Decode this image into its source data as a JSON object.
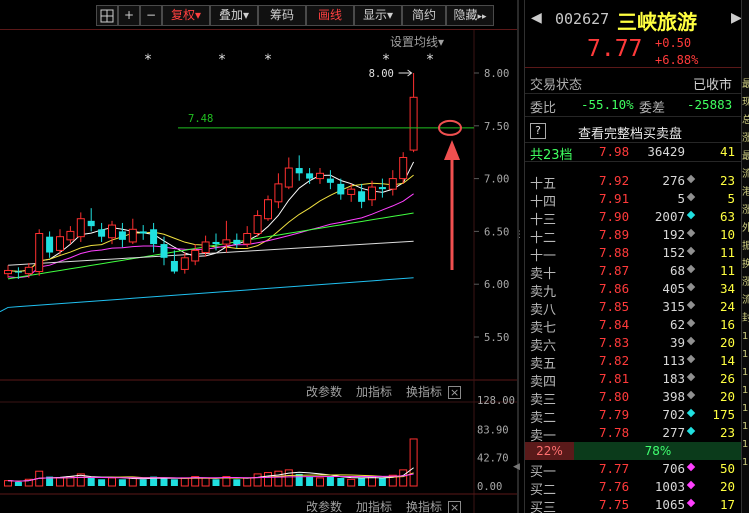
{
  "toolbar": {
    "grid_icon": "grid-icon",
    "plus": "+",
    "minus": "−",
    "buttons": [
      {
        "label": "复权",
        "has_dropdown": true,
        "red": true
      },
      {
        "label": "叠加",
        "has_dropdown": true,
        "red": false
      },
      {
        "label": "筹码",
        "has_dropdown": false,
        "red": false
      },
      {
        "label": "画线",
        "has_dropdown": false,
        "red": true
      },
      {
        "label": "显示",
        "has_dropdown": true,
        "red": false
      },
      {
        "label": "简约",
        "has_dropdown": false,
        "red": false
      },
      {
        "label": "隐藏",
        "has_dropdown": false,
        "red": false
      }
    ],
    "more": "▸▸",
    "settings": "设置均线",
    "dropdown_arrow": "▾"
  },
  "main_chart": {
    "y_ticks": [
      "8.00",
      "7.50",
      "7.00",
      "6.50",
      "6.00",
      "5.50"
    ],
    "annotation_high": "8.00",
    "annotation_line": "7.48",
    "star": "*",
    "colors": {
      "up": "#ff3030",
      "down": "#20e0e0",
      "ma5": "#ffffff",
      "ma10": "#f0e040",
      "ma20": "#ff40ff",
      "ma30": "#40ff40",
      "ma60": "#dcdcdc",
      "ma120": "#20c0f0",
      "hline": "#20c020",
      "arrow": "#f05050"
    }
  },
  "sub_chart": {
    "menu_top": [
      "改参数",
      "加指标",
      "换指标"
    ],
    "menu_bottom": [
      "改参数",
      "加指标",
      "换指标"
    ],
    "close": "×",
    "y_ticks": [
      "128.00",
      "83.90",
      "42.70",
      "0.00"
    ]
  },
  "quote": {
    "prev": "◀",
    "next": "▶",
    "code": "002627",
    "name": "三峡旅游",
    "price": "7.77",
    "change": "+0.50",
    "change_pct": "+6.88%",
    "status_label": "交易状态",
    "status_value": "已收市",
    "weibi_label": "委比",
    "weibi_value": "-55.10%",
    "weicha_label": "委差",
    "weicha_value": "-25883",
    "full_book_icon": "?",
    "full_book_label": "查看完整档买卖盘",
    "total_label": "共23档",
    "total_price": "7.98",
    "total_vol": "36429",
    "total_cnt": "41",
    "ask_rows": [
      {
        "label": "十五",
        "price": "7.92",
        "vol": "276",
        "dot": "gray",
        "cnt": "23"
      },
      {
        "label": "十四",
        "price": "7.91",
        "vol": "5",
        "dot": "gray",
        "cnt": "5"
      },
      {
        "label": "十三",
        "price": "7.90",
        "vol": "2007",
        "dot": "cyan",
        "cnt": "63"
      },
      {
        "label": "十二",
        "price": "7.89",
        "vol": "192",
        "dot": "gray",
        "cnt": "10"
      },
      {
        "label": "十一",
        "price": "7.88",
        "vol": "152",
        "dot": "gray",
        "cnt": "11"
      },
      {
        "label": "卖十",
        "price": "7.87",
        "vol": "68",
        "dot": "gray",
        "cnt": "11"
      },
      {
        "label": "卖九",
        "price": "7.86",
        "vol": "405",
        "dot": "gray",
        "cnt": "34"
      },
      {
        "label": "卖八",
        "price": "7.85",
        "vol": "315",
        "dot": "gray",
        "cnt": "24"
      },
      {
        "label": "卖七",
        "price": "7.84",
        "vol": "62",
        "dot": "gray",
        "cnt": "16"
      },
      {
        "label": "卖六",
        "price": "7.83",
        "vol": "39",
        "dot": "gray",
        "cnt": "20"
      },
      {
        "label": "卖五",
        "price": "7.82",
        "vol": "113",
        "dot": "gray",
        "cnt": "14"
      },
      {
        "label": "卖四",
        "price": "7.81",
        "vol": "183",
        "dot": "gray",
        "cnt": "26"
      },
      {
        "label": "卖三",
        "price": "7.80",
        "vol": "398",
        "dot": "gray",
        "cnt": "20"
      },
      {
        "label": "卖二",
        "price": "7.79",
        "vol": "702",
        "dot": "cyan",
        "cnt": "175"
      },
      {
        "label": "卖一",
        "price": "7.78",
        "vol": "277",
        "dot": "cyan",
        "cnt": "23"
      }
    ],
    "ratio_left": "22%",
    "ratio_right": "78%",
    "bid_rows": [
      {
        "label": "买一",
        "price": "7.77",
        "vol": "706",
        "dot": "mag",
        "cnt": "50"
      },
      {
        "label": "买二",
        "price": "7.76",
        "vol": "1003",
        "dot": "mag",
        "cnt": "20"
      },
      {
        "label": "买三",
        "price": "7.75",
        "vol": "1065",
        "dot": "mag",
        "cnt": "17"
      }
    ]
  }
}
